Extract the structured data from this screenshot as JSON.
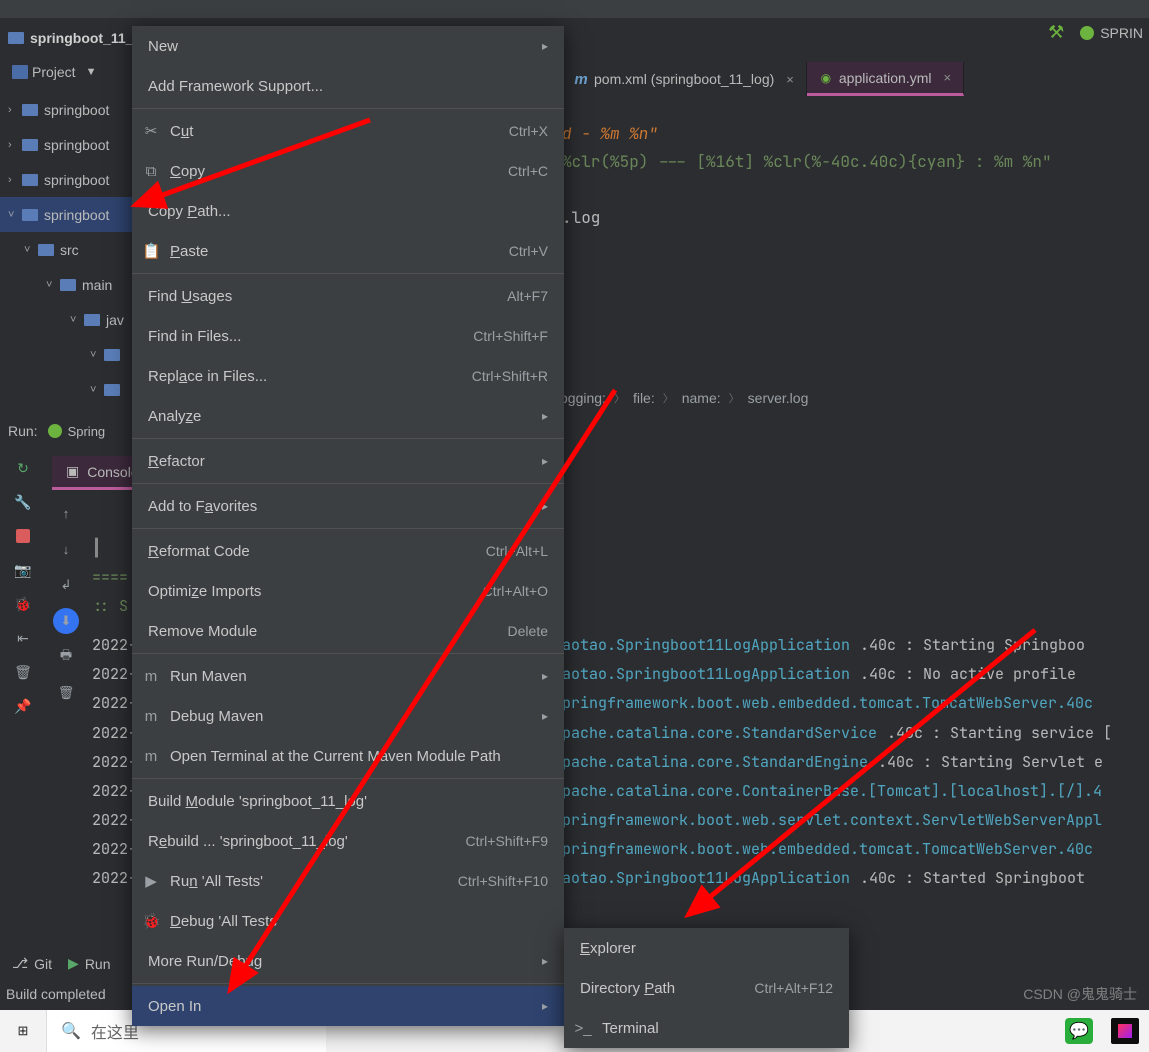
{
  "project": {
    "title": "springboot_11_",
    "tool_label": "Project"
  },
  "tree": {
    "items": [
      {
        "label": "springboot"
      },
      {
        "label": "springboot"
      },
      {
        "label": "springboot"
      },
      {
        "label": "springboot",
        "sel": true
      },
      {
        "label": "src",
        "indent": 1
      },
      {
        "label": "main",
        "indent": 2
      },
      {
        "label": "jav",
        "indent": 3
      },
      {
        "label": "",
        "indent": 4
      },
      {
        "label": "",
        "indent": 4
      }
    ]
  },
  "tabs": {
    "pom": "pom.xml (springboot_11_log)",
    "yml": "application.yml"
  },
  "editor": {
    "line1": "d - %m %n\"",
    "line2": "%clr(%5p) --- [%16t] %clr(%-40c.40c){cyan} : %m %n\"",
    "line3": ".log"
  },
  "breadcrumb": {
    "a": "ogging:",
    "b": "file:",
    "c": "name:",
    "d": "server.log"
  },
  "run": {
    "label": "Run:",
    "config": "Spring",
    "console": "Console"
  },
  "consoleHead": {
    "l1": "====",
    "l2": ":: S"
  },
  "logs": [
    {
      "ts": "2022-",
      "cls": "com.taotao.Springboot11LogApplication",
      "ext": ".40c",
      "msg": "Starting Springboo"
    },
    {
      "ts": "2022-",
      "cls": "com.taotao.Springboot11LogApplication",
      "ext": ".40c",
      "msg": "No active profile"
    },
    {
      "ts": "2022-",
      "cls": "org.springframework.boot.web.embedded.tomcat.TomcatWebServer.40c",
      "ext": "",
      "msg": ""
    },
    {
      "ts": "2022-",
      "cls": "org.apache.catalina.core.StandardService",
      "ext": ".40c",
      "msg": "Starting service ["
    },
    {
      "ts": "2022-",
      "cls": "org.apache.catalina.core.StandardEngine",
      "ext": ".40c",
      "msg": "Starting Servlet e"
    },
    {
      "ts": "2022-",
      "cls": "org.apache.catalina.core.ContainerBase.[Tomcat].[localhost].[/].4",
      "ext": "",
      "msg": ""
    },
    {
      "ts": "2022-",
      "cls": "org.springframework.boot.web.servlet.context.ServletWebServerAppl",
      "ext": "",
      "msg": ""
    },
    {
      "ts": "2022-",
      "cls": "org.springframework.boot.web.embedded.tomcat.TomcatWebServer.40c",
      "ext": "",
      "msg": ""
    },
    {
      "ts": "2022-",
      "cls": "com.taotao.Springboot11LogApplication",
      "ext": ".40c",
      "msg": "Started Springboot"
    }
  ],
  "ctx": [
    {
      "t": "item",
      "label": "New",
      "arrow": true
    },
    {
      "t": "item",
      "label": "Add Framework Support..."
    },
    {
      "t": "sep"
    },
    {
      "t": "item",
      "label": "Cut",
      "sc": "Ctrl+X",
      "icon": "✂",
      "pre": "C",
      "u": "u",
      "post": "t"
    },
    {
      "t": "item",
      "label": "Copy",
      "sc": "Ctrl+C",
      "icon": "⧉",
      "pre": "",
      "u": "C",
      "post": "opy"
    },
    {
      "t": "item",
      "label": "Copy Path...",
      "pre": "Copy ",
      "u": "P",
      "post": "ath..."
    },
    {
      "t": "item",
      "label": "Paste",
      "sc": "Ctrl+V",
      "icon": "📋",
      "pre": "",
      "u": "P",
      "post": "aste"
    },
    {
      "t": "sep"
    },
    {
      "t": "item",
      "label": "Find Usages",
      "sc": "Alt+F7",
      "pre": "Find ",
      "u": "U",
      "post": "sages"
    },
    {
      "t": "item",
      "label": "Find in Files...",
      "sc": "Ctrl+Shift+F"
    },
    {
      "t": "item",
      "label": "Replace in Files...",
      "sc": "Ctrl+Shift+R",
      "pre": "Repl",
      "u": "a",
      "post": "ce in Files..."
    },
    {
      "t": "item",
      "label": "Analyze",
      "arrow": true,
      "pre": "Analy",
      "u": "z",
      "post": "e"
    },
    {
      "t": "sep"
    },
    {
      "t": "item",
      "label": "Refactor",
      "arrow": true,
      "pre": "",
      "u": "R",
      "post": "efactor"
    },
    {
      "t": "sep"
    },
    {
      "t": "item",
      "label": "Add to Favorites",
      "arrow": true,
      "pre": "Add to F",
      "u": "a",
      "post": "vorites"
    },
    {
      "t": "sep"
    },
    {
      "t": "item",
      "label": "Reformat Code",
      "sc": "Ctrl+Alt+L",
      "pre": "",
      "u": "R",
      "post": "eformat Code"
    },
    {
      "t": "item",
      "label": "Optimize Imports",
      "sc": "Ctrl+Alt+O",
      "pre": "Optimi",
      "u": "z",
      "post": "e Imports"
    },
    {
      "t": "item",
      "label": "Remove Module",
      "sc": "Delete"
    },
    {
      "t": "sep"
    },
    {
      "t": "item",
      "label": "Run Maven",
      "arrow": true,
      "icon": "m"
    },
    {
      "t": "item",
      "label": "Debug Maven",
      "arrow": true,
      "icon": "m"
    },
    {
      "t": "item",
      "label": "Open Terminal at the Current Maven Module Path",
      "icon": "m"
    },
    {
      "t": "sep"
    },
    {
      "t": "item",
      "label": "Build Module 'springboot_11_log'",
      "pre": "Build ",
      "u": "M",
      "post": "odule 'springboot_11_log'"
    },
    {
      "t": "item",
      "label": "Rebuild ... 'springboot_11_log'",
      "sc": "Ctrl+Shift+F9",
      "pre": "R",
      "u": "e",
      "post": "build ... 'springboot_11_log'"
    },
    {
      "t": "item",
      "label": "Run 'All Tests'",
      "sc": "Ctrl+Shift+F10",
      "icon": "▶",
      "iconcls": "grn-tri",
      "pre": "Ru",
      "u": "n",
      "post": " 'All Tests'"
    },
    {
      "t": "item",
      "label": "Debug 'All Tests'",
      "icon": "🐞",
      "iconcls": "bug-ico",
      "pre": "",
      "u": "D",
      "post": "ebug 'All Tests'"
    },
    {
      "t": "item",
      "label": "More Run/Debug",
      "arrow": true
    },
    {
      "t": "sep"
    },
    {
      "t": "item",
      "label": "Open In",
      "arrow": true,
      "hl": true
    }
  ],
  "sub": [
    {
      "label": "Explorer",
      "pre": "",
      "u": "E",
      "post": "xplorer"
    },
    {
      "label": "Directory Path",
      "sc": "Ctrl+Alt+F12",
      "pre": "Directory ",
      "u": "P",
      "post": "ath"
    },
    {
      "label": "Terminal",
      "icon": ">_"
    }
  ],
  "bottom": {
    "git": "Git",
    "run": "Run",
    "build": "Build completed"
  },
  "taskbar": {
    "search": "在这里"
  },
  "watermark": "CSDN @鬼鬼骑士",
  "topright": {
    "label": "SPRIN"
  }
}
